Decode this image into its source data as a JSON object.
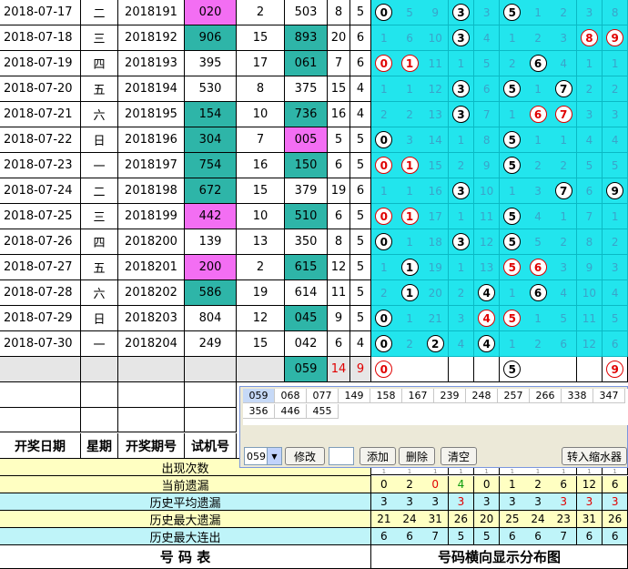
{
  "rows": [
    {
      "date": "2018-07-17",
      "wd": "二",
      "issue": "2018191",
      "test": "020",
      "test_color": "pink",
      "span": "2",
      "draw": "503",
      "draw_color": "none",
      "sum": "8",
      "k": "5",
      "grid": [
        "c0",
        "5",
        "9",
        "c3",
        "3",
        "c5",
        "1",
        "2",
        "3",
        "8"
      ]
    },
    {
      "date": "2018-07-18",
      "wd": "三",
      "issue": "2018192",
      "test": "906",
      "test_color": "teal",
      "span": "15",
      "draw": "893",
      "draw_color": "teal",
      "sum": "20",
      "k": "6",
      "grid": [
        "1",
        "6",
        "10",
        "c3",
        "4",
        "1",
        "2",
        "3",
        "r8",
        "r9"
      ]
    },
    {
      "date": "2018-07-19",
      "wd": "四",
      "issue": "2018193",
      "test": "395",
      "test_color": "none",
      "span": "17",
      "draw": "061",
      "draw_color": "teal",
      "sum": "7",
      "k": "6",
      "grid": [
        "r0",
        "r1",
        "11",
        "1",
        "5",
        "2",
        "c6",
        "4",
        "1",
        "1"
      ]
    },
    {
      "date": "2018-07-20",
      "wd": "五",
      "issue": "2018194",
      "test": "530",
      "test_color": "none",
      "span": "8",
      "draw": "375",
      "draw_color": "none",
      "sum": "15",
      "k": "4",
      "grid": [
        "1",
        "1",
        "12",
        "c3",
        "6",
        "c5",
        "1",
        "c7",
        "2",
        "2"
      ]
    },
    {
      "date": "2018-07-21",
      "wd": "六",
      "issue": "2018195",
      "test": "154",
      "test_color": "teal",
      "span": "10",
      "draw": "736",
      "draw_color": "teal",
      "sum": "16",
      "k": "4",
      "grid": [
        "2",
        "2",
        "13",
        "c3",
        "7",
        "1",
        "r6",
        "r7",
        "3",
        "3"
      ]
    },
    {
      "date": "2018-07-22",
      "wd": "日",
      "issue": "2018196",
      "test": "304",
      "test_color": "teal",
      "span": "7",
      "draw": "005",
      "draw_color": "pink",
      "sum": "5",
      "k": "5",
      "grid": [
        "c0",
        "3",
        "14",
        "1",
        "8",
        "c5",
        "1",
        "1",
        "4",
        "4"
      ]
    },
    {
      "date": "2018-07-23",
      "wd": "一",
      "issue": "2018197",
      "test": "754",
      "test_color": "teal",
      "span": "16",
      "draw": "150",
      "draw_color": "teal",
      "sum": "6",
      "k": "5",
      "grid": [
        "r0",
        "r1",
        "15",
        "2",
        "9",
        "c5",
        "2",
        "2",
        "5",
        "5"
      ]
    },
    {
      "date": "2018-07-24",
      "wd": "二",
      "issue": "2018198",
      "test": "672",
      "test_color": "teal",
      "span": "15",
      "draw": "379",
      "draw_color": "none",
      "sum": "19",
      "k": "6",
      "grid": [
        "1",
        "1",
        "16",
        "c3",
        "10",
        "1",
        "3",
        "c7",
        "6",
        "c9"
      ]
    },
    {
      "date": "2018-07-25",
      "wd": "三",
      "issue": "2018199",
      "test": "442",
      "test_color": "pink",
      "span": "10",
      "draw": "510",
      "draw_color": "teal",
      "sum": "6",
      "k": "5",
      "grid": [
        "r0",
        "r1",
        "17",
        "1",
        "11",
        "c5",
        "4",
        "1",
        "7",
        "1"
      ]
    },
    {
      "date": "2018-07-26",
      "wd": "四",
      "issue": "2018200",
      "test": "139",
      "test_color": "none",
      "span": "13",
      "draw": "350",
      "draw_color": "none",
      "sum": "8",
      "k": "5",
      "grid": [
        "c0",
        "1",
        "18",
        "c3",
        "12",
        "c5",
        "5",
        "2",
        "8",
        "2"
      ]
    },
    {
      "date": "2018-07-27",
      "wd": "五",
      "issue": "2018201",
      "test": "200",
      "test_color": "pink",
      "span": "2",
      "draw": "615",
      "draw_color": "teal",
      "sum": "12",
      "k": "5",
      "grid": [
        "1",
        "c1",
        "19",
        "1",
        "13",
        "r5",
        "r6",
        "3",
        "9",
        "3"
      ]
    },
    {
      "date": "2018-07-28",
      "wd": "六",
      "issue": "2018202",
      "test": "586",
      "test_color": "teal",
      "span": "19",
      "draw": "614",
      "draw_color": "none",
      "sum": "11",
      "k": "5",
      "grid": [
        "2",
        "c1",
        "20",
        "2",
        "c4",
        "1",
        "c6",
        "4",
        "10",
        "4"
      ]
    },
    {
      "date": "2018-07-29",
      "wd": "日",
      "issue": "2018203",
      "test": "804",
      "test_color": "none",
      "span": "12",
      "draw": "045",
      "draw_color": "teal",
      "sum": "9",
      "k": "5",
      "grid": [
        "c0",
        "1",
        "21",
        "3",
        "r4",
        "r5",
        "1",
        "5",
        "11",
        "5"
      ]
    },
    {
      "date": "2018-07-30",
      "wd": "一",
      "issue": "2018204",
      "test": "249",
      "test_color": "none",
      "span": "15",
      "draw": "042",
      "draw_color": "none",
      "sum": "6",
      "k": "4",
      "grid": [
        "c0",
        "2",
        "c2",
        "4",
        "c4",
        "1",
        "2",
        "6",
        "12",
        "6"
      ]
    }
  ],
  "predict": {
    "draw": "059",
    "sum": "14",
    "k": "9",
    "grid": [
      "r0",
      "",
      "",
      "",
      "",
      "c5",
      "",
      "",
      "",
      "r9"
    ]
  },
  "header": {
    "date": "开奖日期",
    "wd": "星期",
    "issue": "开奖期号",
    "test": "试机号"
  },
  "stats": {
    "title": "出现次数",
    "rows": [
      {
        "label": "当前遗漏",
        "values": [
          "0",
          "2",
          "0",
          "4",
          "0",
          "1",
          "2",
          "6",
          "12",
          "6"
        ],
        "colors": [
          "n",
          "n",
          "r",
          "g",
          "n",
          "n",
          "n",
          "n",
          "n",
          "n"
        ]
      },
      {
        "label": "历史平均遗漏",
        "values": [
          "3",
          "3",
          "3",
          "3",
          "3",
          "3",
          "3",
          "3",
          "3",
          "3"
        ],
        "colors": [
          "n",
          "n",
          "n",
          "r",
          "n",
          "n",
          "n",
          "r",
          "r",
          "r"
        ]
      },
      {
        "label": "历史最大遗漏",
        "values": [
          "21",
          "24",
          "31",
          "26",
          "20",
          "25",
          "24",
          "23",
          "31",
          "26"
        ],
        "colors": [
          "n",
          "n",
          "n",
          "n",
          "n",
          "n",
          "n",
          "n",
          "n",
          "n"
        ]
      },
      {
        "label": "历史最大连出",
        "values": [
          "6",
          "6",
          "7",
          "5",
          "5",
          "6",
          "6",
          "7",
          "6",
          "6"
        ],
        "colors": [
          "n",
          "n",
          "n",
          "n",
          "n",
          "n",
          "n",
          "n",
          "n",
          "n"
        ]
      }
    ],
    "partial_top": [
      "1",
      "1",
      "1",
      "1",
      "1",
      "1",
      "1",
      "1",
      "1",
      "1"
    ]
  },
  "bottom": {
    "left": "号    码    表",
    "right": "号码横向显示分布图"
  },
  "popup": {
    "numbers": [
      "059",
      "068",
      "077",
      "149",
      "158",
      "167",
      "239",
      "248",
      "257",
      "266",
      "338",
      "347",
      "356",
      "446",
      "455"
    ],
    "select_value": "059",
    "btn_modify": "修改",
    "btn_add": "添加",
    "btn_delete": "删除",
    "btn_clear": "清空",
    "btn_transfer": "转入缩水器",
    "dropdown_icon": "▼"
  }
}
